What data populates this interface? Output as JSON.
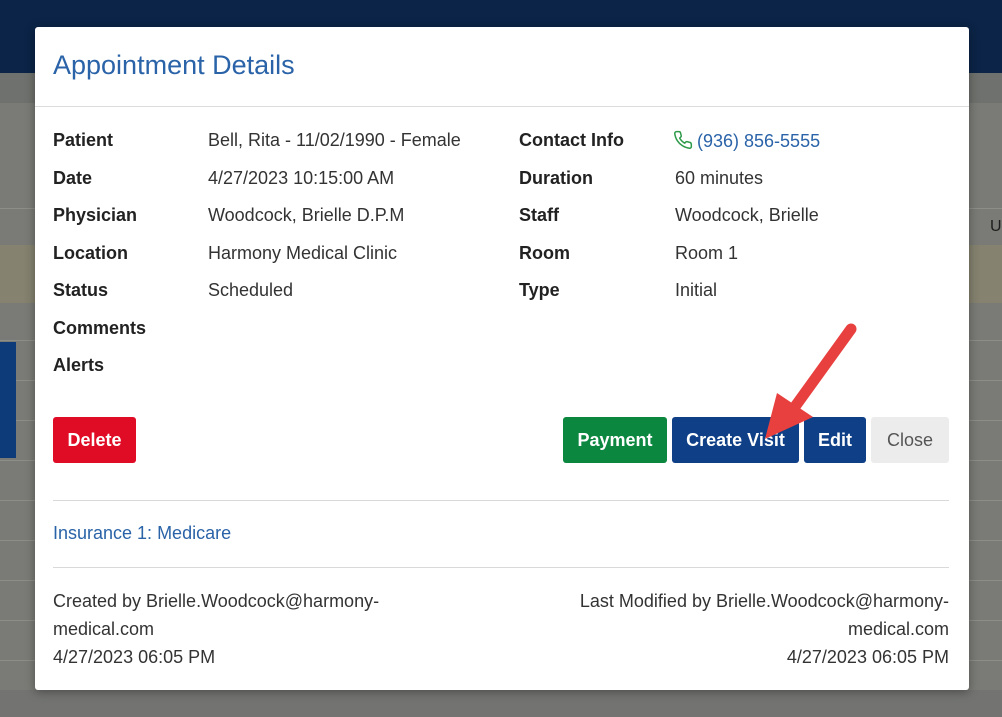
{
  "modal": {
    "title": "Appointment Details"
  },
  "details_left": [
    {
      "label": "Patient",
      "value": "Bell, Rita - 11/02/1990 - Female"
    },
    {
      "label": "Date",
      "value": "4/27/2023 10:15:00 AM"
    },
    {
      "label": "Physician",
      "value": "Woodcock, Brielle D.P.M"
    },
    {
      "label": "Location",
      "value": "Harmony Medical Clinic"
    },
    {
      "label": "Status",
      "value": "Scheduled"
    },
    {
      "label": "Comments",
      "value": ""
    },
    {
      "label": "Alerts",
      "value": ""
    }
  ],
  "details_right": [
    {
      "label": "Contact Info",
      "value": "(936) 856-5555",
      "icon": "phone-icon"
    },
    {
      "label": "Duration",
      "value": "60 minutes"
    },
    {
      "label": "Staff",
      "value": "Woodcock, Brielle"
    },
    {
      "label": "Room",
      "value": "Room 1"
    },
    {
      "label": "Type",
      "value": "Initial"
    }
  ],
  "buttons": {
    "delete": "Delete",
    "payment": "Payment",
    "create_visit": "Create Visit",
    "edit": "Edit",
    "close": "Close"
  },
  "insurance": "Insurance 1: Medicare",
  "footer": {
    "created_line1": "Created by Brielle.Woodcock@harmony-",
    "created_line2": "medical.com",
    "created_time": "4/27/2023 06:05 PM",
    "modified_line1": "Last Modified by Brielle.Woodcock@harmony-",
    "modified_line2": "medical.com",
    "modified_time": "4/27/2023 06:05 PM"
  },
  "background": {
    "partial_text": "U"
  },
  "colors": {
    "title": "#2a63a8",
    "delete": "#e00b25",
    "payment": "#0b8740",
    "primary": "#0e3f87",
    "arrow": "#e8403e"
  }
}
